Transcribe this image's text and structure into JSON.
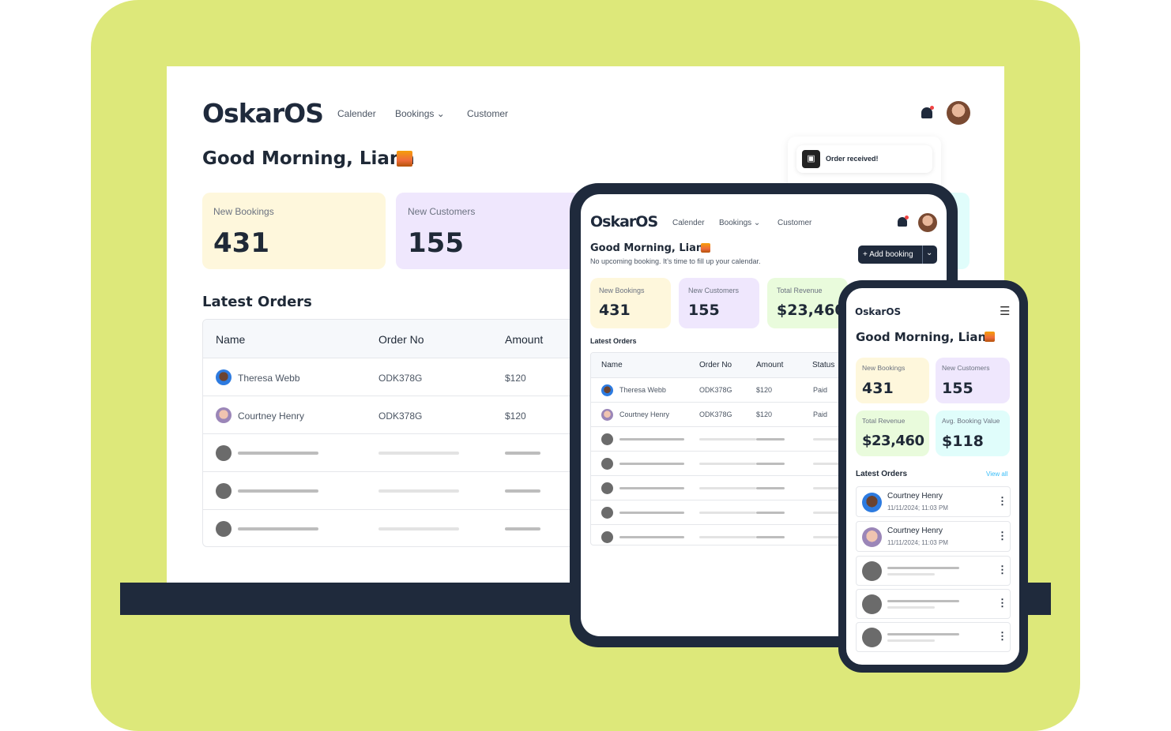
{
  "brand": "OskarOS",
  "nav": {
    "calendar": "Calender",
    "bookings": "Bookings",
    "customer": "Customer"
  },
  "greeting": "Good Morning, Liana",
  "subtitle": "No upcoming booking. It’s time to fill up your calendar.",
  "add_booking": "+ Add booking",
  "notification": "Order received!",
  "stats": {
    "new_bookings": {
      "label": "New Bookings",
      "value": "431"
    },
    "new_customers": {
      "label": "New Customers",
      "value": "155"
    },
    "total_revenue": {
      "label": "Total Revenue",
      "value": "$23,460"
    },
    "avg_booking": {
      "label": "Avg. Booking Value",
      "value": "$118"
    }
  },
  "latest_orders": "Latest Orders",
  "view_all": "View all",
  "table": {
    "headers": [
      "Name",
      "Order No",
      "Amount",
      "Status"
    ],
    "rows": [
      {
        "name": "Theresa Webb",
        "order": "ODK378G",
        "amount": "$120",
        "status": "Paid"
      },
      {
        "name": "Courtney Henry",
        "order": "ODK378G",
        "amount": "$120",
        "status": "Paid"
      }
    ]
  },
  "mobile_orders": [
    {
      "name": "Courtney Henry",
      "time": "11/11/2024; 11:03 PM"
    },
    {
      "name": "Courtney Henry",
      "time": "11/11/2024; 11:03 PM"
    }
  ],
  "colors": {
    "background": "#dde87a",
    "device": "#1f2a3c",
    "bookings": "#fef7dc",
    "customers": "#efe7fd",
    "revenue": "#e9fbdc",
    "avg": "#e0fdfb"
  }
}
